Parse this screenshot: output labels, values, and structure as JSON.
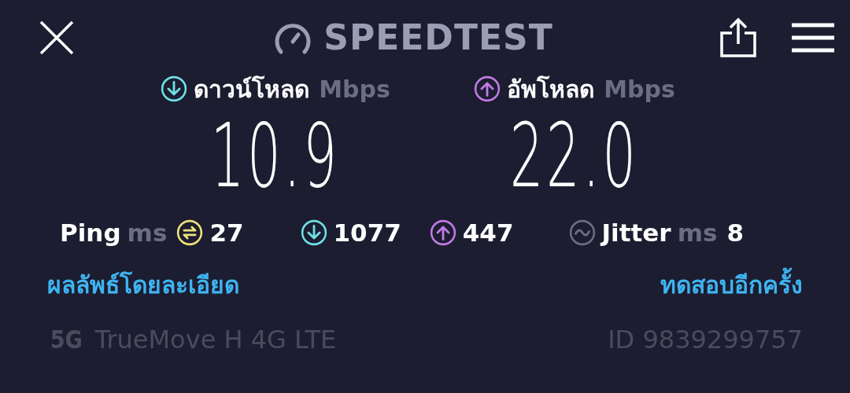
{
  "header": {
    "title": "SPEEDTEST"
  },
  "results": [
    {
      "kind": "download",
      "label": "ดาวน์โหลด",
      "unit": "Mbps",
      "value": "10.9"
    },
    {
      "kind": "upload",
      "label": "อัพโหลด",
      "unit": "Mbps",
      "value": "22.0"
    }
  ],
  "metrics": [
    {
      "kind": "ping",
      "label": "Ping",
      "unit": "ms",
      "value": "27"
    },
    {
      "kind": "download",
      "value": "1077"
    },
    {
      "kind": "upload",
      "value": "447"
    },
    {
      "kind": "jitter",
      "label": "Jitter",
      "unit": "ms",
      "value": "8"
    }
  ],
  "links": {
    "details": "ผลลัพธ์โดยละเอียด",
    "retest": "ทดสอบอีกครั้ง"
  },
  "footer": {
    "network_badge": "5G",
    "carrier": "TrueMove H 4G LTE",
    "id": "ID 9839299757"
  }
}
